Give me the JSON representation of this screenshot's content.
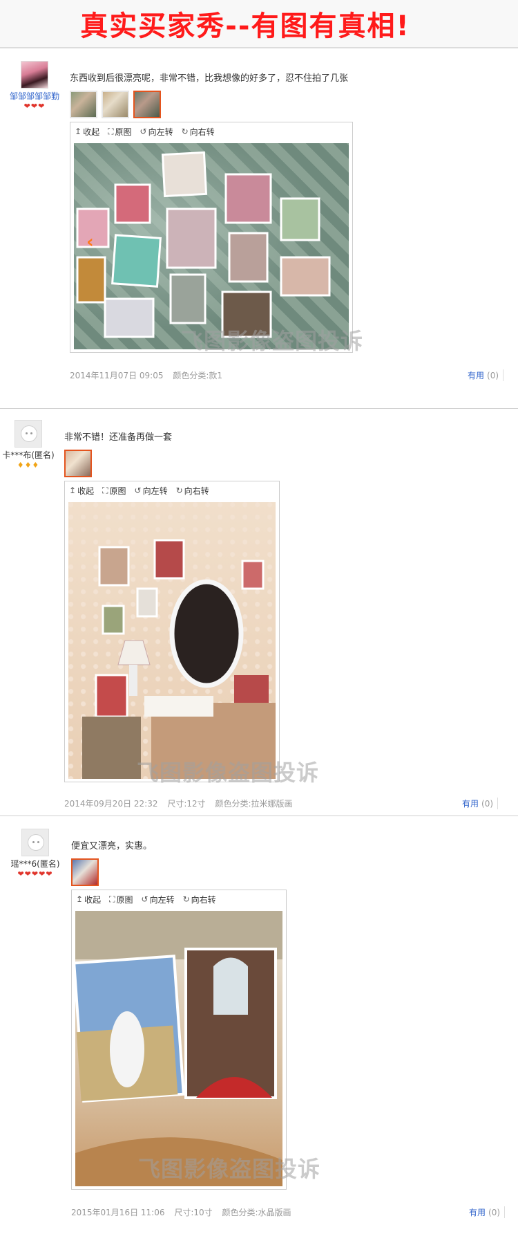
{
  "banner": {
    "title": "真实买家秀--有图有真相!"
  },
  "toolbar": {
    "collapse": "收起",
    "original": "原图",
    "rotate_left": "向左转",
    "rotate_right": "向右转"
  },
  "watermark": "飞图影像盗图投诉",
  "reviews": [
    {
      "username": "邹邹邹邹邹勤",
      "badges": "❤❤❤",
      "text": "东西收到后很漂亮呢，非常不错，比我想像的好多了，忍不住拍了几张",
      "date": "2014年11月07日 09:05",
      "size": "",
      "color": "颜色分类:款1",
      "useful_label": "有用",
      "useful_count": "(0)"
    },
    {
      "username": "卡***布(匿名)",
      "badges": "♦♦♦",
      "text": "非常不错！还准备再做一套",
      "date": "2014年09月20日 22:32",
      "size": "尺寸:12寸",
      "color": "颜色分类:拉米娜版画",
      "useful_label": "有用",
      "useful_count": "(0)"
    },
    {
      "username": "瑶***6(匿名)",
      "badges": "❤❤❤❤❤",
      "text": "便宜又漂亮，实惠。",
      "date": "2015年01月16日 11:06",
      "size": "尺寸:10寸",
      "color": "颜色分类:水晶版画",
      "useful_label": "有用",
      "useful_count": "(0)"
    }
  ],
  "colors": {
    "accent": "#e4541e",
    "link": "#3366cc",
    "banner_text": "#ff1a1a"
  }
}
